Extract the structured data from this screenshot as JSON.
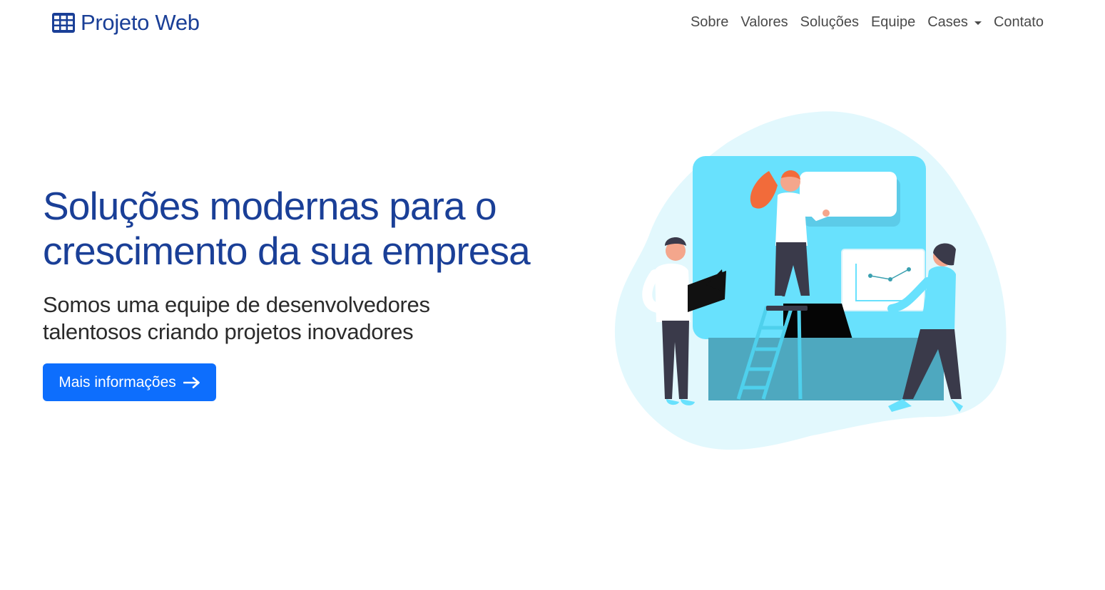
{
  "navbar": {
    "brand": "Projeto Web",
    "brand_icon": "grid-table-icon",
    "links": [
      {
        "label": "Sobre"
      },
      {
        "label": "Valores"
      },
      {
        "label": "Soluções"
      },
      {
        "label": "Equipe"
      },
      {
        "label": "Cases",
        "dropdown": true
      },
      {
        "label": "Contato"
      }
    ]
  },
  "hero": {
    "title": "Soluções modernas para o crescimento da sua empresa",
    "subtitle": "Somos uma equipe de desenvolvedores talentosos criando projetos inovadores",
    "cta_label": "Mais informações",
    "cta_icon": "arrow-right-icon",
    "illustration": "team-presentation-illustration"
  },
  "colors": {
    "primary": "#0d6efd",
    "heading": "#1a3f97",
    "text": "#2b2b2b",
    "accent": "#68e1fd",
    "blob": "#e2f8fd"
  }
}
